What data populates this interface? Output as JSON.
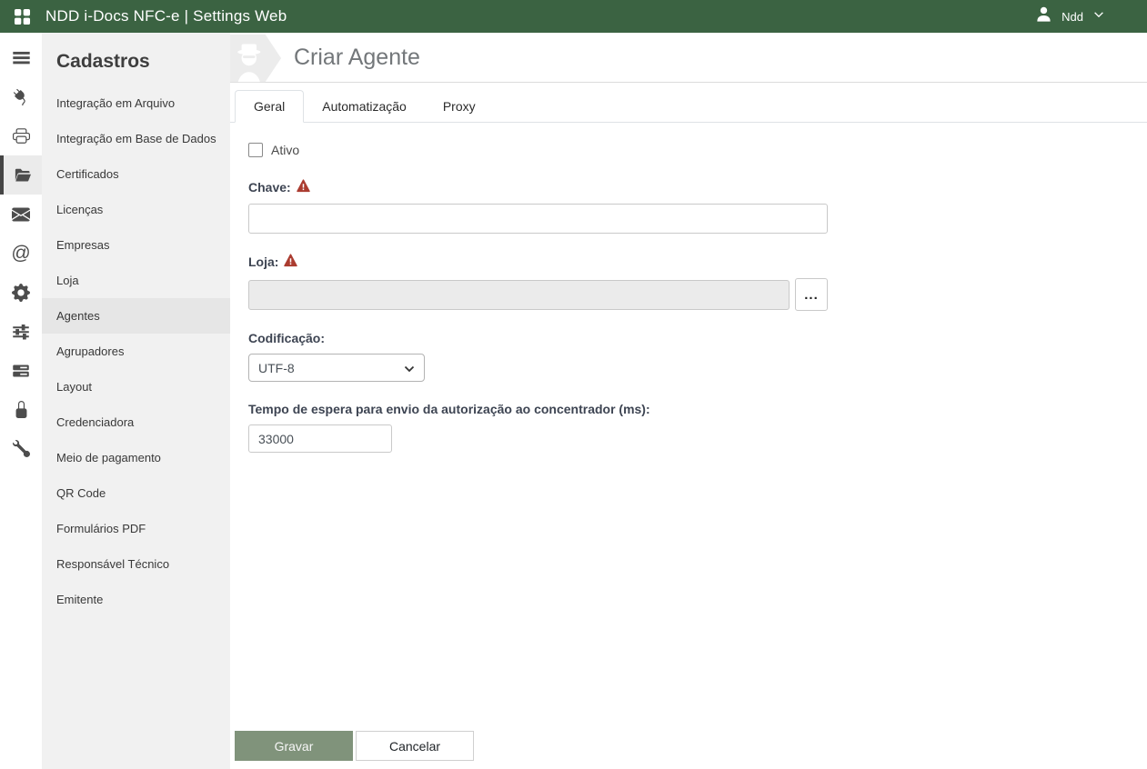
{
  "topbar": {
    "title": "NDD i-Docs NFC-e | Settings Web",
    "user_name": "Ndd"
  },
  "rail": {
    "icons": [
      "menu-icon",
      "plug-icon",
      "printer-icon",
      "folder-open-icon",
      "envelope-icon",
      "at-icon",
      "gear-icon",
      "sliders-icon",
      "server-icon",
      "lock-icon",
      "wrench-icon"
    ],
    "active_icon": "folder-open-icon",
    "at_glyph": "@"
  },
  "sidebar": {
    "title": "Cadastros",
    "items": [
      {
        "label": "Integração em Arquivo",
        "active": false
      },
      {
        "label": "Integração em Base de Dados",
        "active": false
      },
      {
        "label": "Certificados",
        "active": false
      },
      {
        "label": "Licenças",
        "active": false
      },
      {
        "label": "Empresas",
        "active": false
      },
      {
        "label": "Loja",
        "active": false
      },
      {
        "label": "Agentes",
        "active": true
      },
      {
        "label": "Agrupadores",
        "active": false
      },
      {
        "label": "Layout",
        "active": false
      },
      {
        "label": "Credenciadora",
        "active": false
      },
      {
        "label": "Meio de pagamento",
        "active": false
      },
      {
        "label": "QR Code",
        "active": false
      },
      {
        "label": "Formulários PDF",
        "active": false
      },
      {
        "label": "Responsável Técnico",
        "active": false
      },
      {
        "label": "Emitente",
        "active": false
      }
    ]
  },
  "main": {
    "page_title": "Criar Agente",
    "tabs": [
      {
        "label": "Geral",
        "active": true
      },
      {
        "label": "Automatização",
        "active": false
      },
      {
        "label": "Proxy",
        "active": false
      }
    ],
    "form": {
      "ativo": {
        "label": "Ativo",
        "checked": false
      },
      "chave": {
        "label": "Chave:",
        "value": "",
        "required": true
      },
      "loja": {
        "label": "Loja:",
        "value": "",
        "required": true,
        "disabled": true,
        "browse_label": "..."
      },
      "codificacao": {
        "label": "Codificação:",
        "selected": "UTF-8"
      },
      "tempo_espera": {
        "label": "Tempo de espera para envio da autorização ao concentrador (ms):",
        "value": "33000"
      }
    },
    "actions": {
      "save_label": "Gravar",
      "cancel_label": "Cancelar"
    }
  },
  "colors": {
    "topbar-bg": "#3b6342",
    "save-btn-bg": "#80937b",
    "warning-red": "#ab3c30",
    "sidebar-bg": "#f1f1f1",
    "selected-bg": "#e6e6e6"
  }
}
